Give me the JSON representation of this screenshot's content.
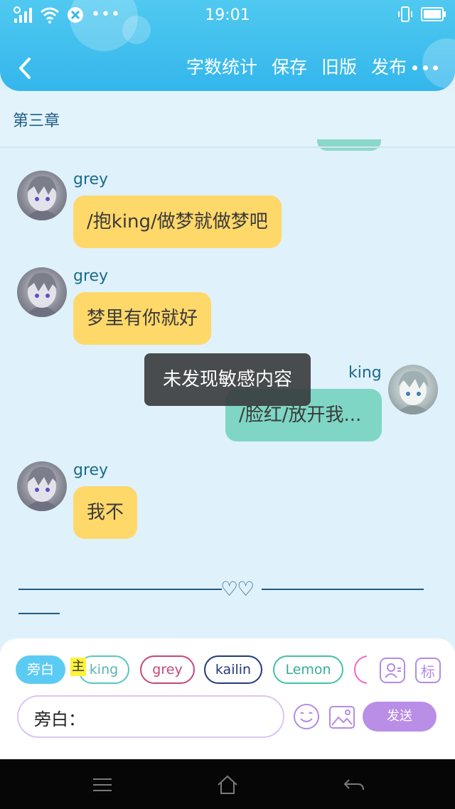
{
  "status": {
    "time": "19:01"
  },
  "toolbar": {
    "word_count": "字数统计",
    "save": "保存",
    "old_version": "旧版",
    "publish": "发布"
  },
  "chapter": {
    "title": "第三章"
  },
  "messages": [
    {
      "sender": "grey",
      "text": "/抱king/做梦就做梦吧",
      "side": "left",
      "color": "#ffd86a"
    },
    {
      "sender": "grey",
      "text": "梦里有你就好",
      "side": "left",
      "color": "#ffd86a"
    },
    {
      "sender": "king",
      "text": "/脸红/放开我...",
      "side": "right",
      "color": "#7fd6c5"
    },
    {
      "sender": "grey",
      "text": "我不",
      "side": "left",
      "color": "#ffd86a"
    }
  ],
  "toast": {
    "text": "未发现敏感内容"
  },
  "separator": {
    "hearts": "♡♡"
  },
  "roles": {
    "narration": "旁白",
    "main_tag": "主",
    "chips": [
      "king",
      "grey",
      "kailin",
      "Lemon"
    ]
  },
  "composer": {
    "prefix": "旁白：",
    "tag_label": "标",
    "send": "发送"
  },
  "colors": {
    "header": "#34b6ec",
    "narration_chip": "#5ccbf3",
    "send_button": "#b98ee6",
    "grey_bubble": "#ffd86a",
    "king_bubble": "#7fd6c5"
  }
}
